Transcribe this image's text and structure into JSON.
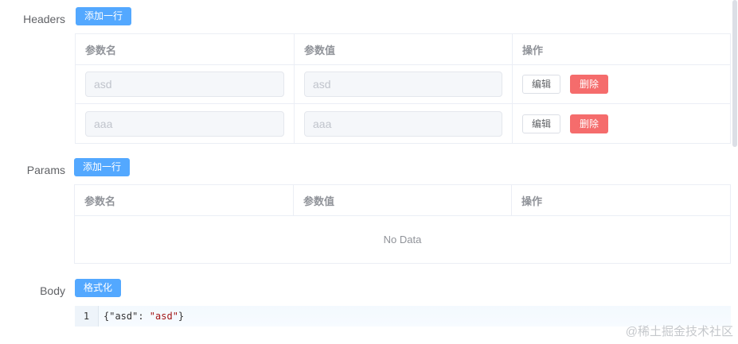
{
  "headers": {
    "label": "Headers",
    "add_label": "添加一行",
    "columns": [
      "参数名",
      "参数值",
      "操作"
    ],
    "rows": [
      {
        "name": "asd",
        "value": "asd"
      },
      {
        "name": "aaa",
        "value": "aaa"
      }
    ],
    "edit_label": "编辑",
    "delete_label": "删除"
  },
  "params": {
    "label": "Params",
    "add_label": "添加一行",
    "columns": [
      "参数名",
      "参数值",
      "操作"
    ],
    "empty_text": "No Data"
  },
  "body": {
    "label": "Body",
    "format_label": "格式化",
    "line_number": "1",
    "code_prefix": "{\"asd\": ",
    "code_string": "\"asd\"",
    "code_suffix": "}"
  },
  "watermark": "@稀土掘金技术社区"
}
